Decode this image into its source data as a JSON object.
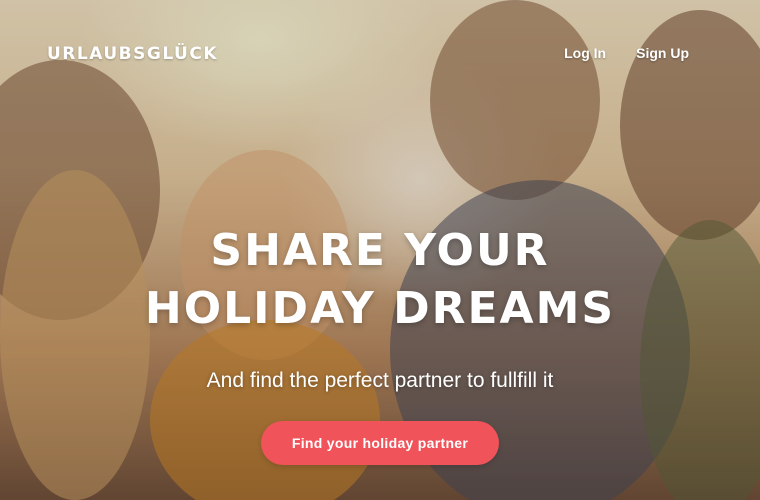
{
  "brand": {
    "logo_text": "URLAUBSGLÜCK"
  },
  "nav": {
    "login_label": "Log In",
    "signup_label": "Sign Up"
  },
  "hero": {
    "headline_line1": "SHARE YOUR",
    "headline_line2": "HOLIDAY DREAMS",
    "subheadline": "And find the perfect partner to fullfill it",
    "cta_label": "Find your holiday partner",
    "background_image": "group of friends laughing outdoors in sunlight"
  },
  "colors": {
    "cta_background": "#f0535a",
    "text": "#ffffff"
  }
}
